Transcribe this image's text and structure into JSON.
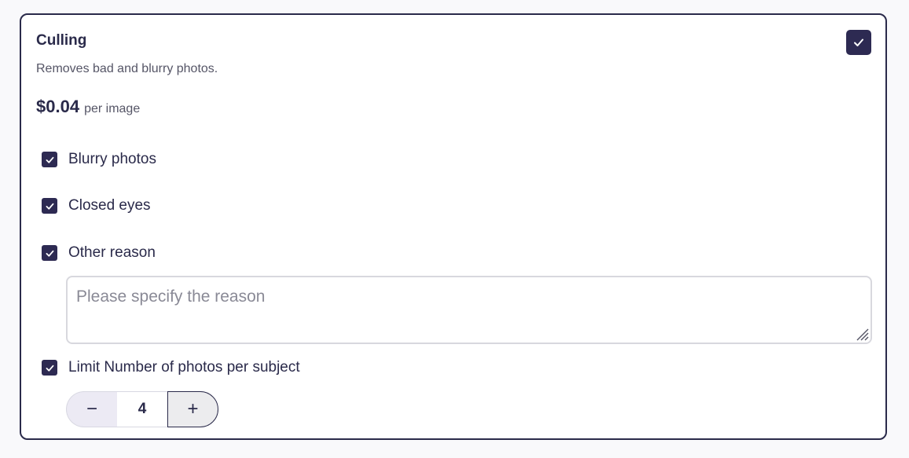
{
  "card": {
    "title": "Culling",
    "description": "Removes bad and blurry photos.",
    "price": "$0.04",
    "price_unit": "per image",
    "enabled": true
  },
  "options": [
    {
      "label": "Blurry photos",
      "checked": true
    },
    {
      "label": "Closed eyes",
      "checked": true
    },
    {
      "label": "Other reason",
      "checked": true
    },
    {
      "label": "Limit Number of photos per subject",
      "checked": true
    }
  ],
  "reason": {
    "placeholder": "Please specify the reason",
    "value": ""
  },
  "stepper": {
    "minus_label": "−",
    "value": "4",
    "plus_label": "+"
  },
  "colors": {
    "accent": "#2d2a52",
    "text": "#2a2a4a",
    "muted": "#555566",
    "border": "#2a2a4a"
  },
  "icons": {
    "main_check": "check-icon",
    "option_check": "check-icon",
    "resize": "resize-grip-icon"
  }
}
